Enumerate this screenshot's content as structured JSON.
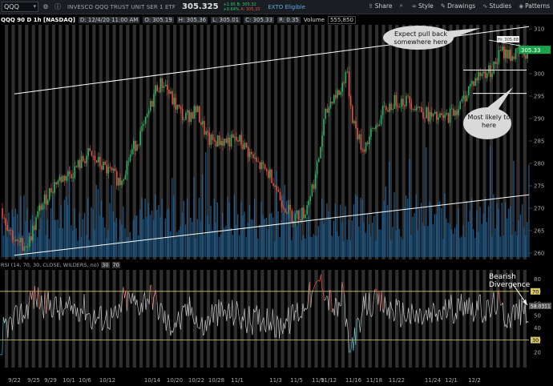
{
  "toolbar": {
    "symbol": "QQQ",
    "company": "INVESCO QQQ TRUST UNIT SER 1 ETF",
    "last_price": "305.325",
    "change_lines": [
      "+1.95",
      "+0.64%",
      "B: 305.32",
      "A: 305.33"
    ],
    "ext_label": "EXTO Eligible",
    "actions": [
      {
        "label": "Share",
        "icon": "share-icon"
      },
      {
        "label": "Style",
        "icon": "style-icon"
      },
      {
        "label": "Drawings",
        "icon": "drawings-icon"
      },
      {
        "label": "Studies",
        "icon": "studies-icon"
      },
      {
        "label": "Patterns",
        "icon": "patterns-icon"
      }
    ]
  },
  "info": {
    "title": "QQQ 90 D 1h [NASDAQ]",
    "date": "D: 12/4/20 11:00 AM",
    "open": "O: 305.19",
    "high": "H: 305.36",
    "low": "L: 305.01",
    "close": "C: 305.33",
    "range": "R: 0.35",
    "volume_label": "Volume",
    "volume_value": "555,850"
  },
  "price_axis": {
    "ticks": [
      "310",
      "305",
      "300",
      "295",
      "290",
      "285",
      "280",
      "275",
      "270",
      "265",
      "260"
    ],
    "current_label": "305.33",
    "hi_label": "Hi: 305.88"
  },
  "rsi": {
    "label": "RSI (14, 70, 30, CLOSE, WILDERS, no)",
    "value_label": "58.0311",
    "param_a": "30",
    "param_b": "70",
    "ticks": [
      "80",
      "70",
      "60",
      "50",
      "40",
      "30",
      "20"
    ],
    "overbought_label": "70",
    "oversold_label": "30"
  },
  "dates": [
    "9/22",
    "9/25",
    "9/29",
    "10/1",
    "10/6",
    "10/12",
    "10/14",
    "10/20",
    "10/22",
    "10/28",
    "11/1",
    "11/3",
    "11/5",
    "11/9",
    "11/12",
    "11/16",
    "11/18",
    "11/22",
    "11/24",
    "12/1",
    "12/2"
  ],
  "annotations": {
    "top": "Expect pull back somewhere here",
    "mid": "Most likely to here",
    "divergence": "Bearish Divergence"
  },
  "colors": {
    "up": "#27ae60",
    "down": "#e74c3c",
    "volume": "#1f6aa5",
    "current": "#1aa34a",
    "line": "#ffffff",
    "rsi_band": "#d6c86a"
  }
}
